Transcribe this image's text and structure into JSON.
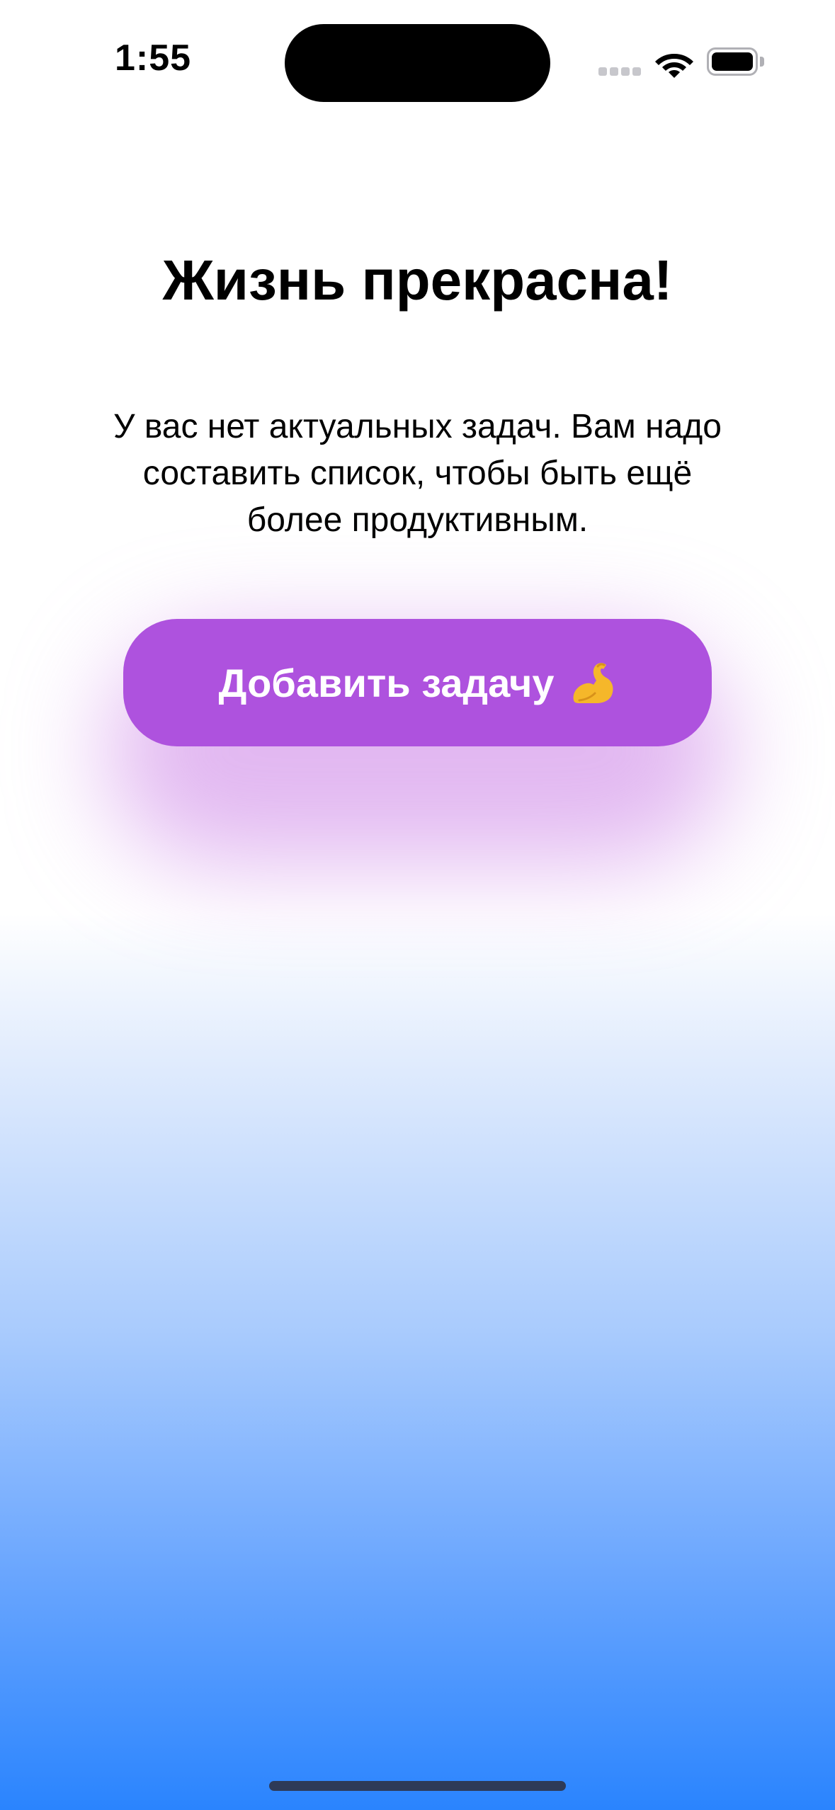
{
  "status_bar": {
    "time": "1:55",
    "icons": [
      "cellular-signal-icon",
      "wifi-icon",
      "battery-icon"
    ]
  },
  "main": {
    "title": "Жизнь прекрасна!",
    "subtitle": "У вас нет актуальных задач. Вам надо составить список, чтобы быть ещё более продуктивным.",
    "add_task_button": {
      "label": "Добавить задачу",
      "icon": "flexed-biceps-icon"
    }
  },
  "colors": {
    "button": "#ae52de",
    "gradient_bottom": "#2a84fe"
  }
}
